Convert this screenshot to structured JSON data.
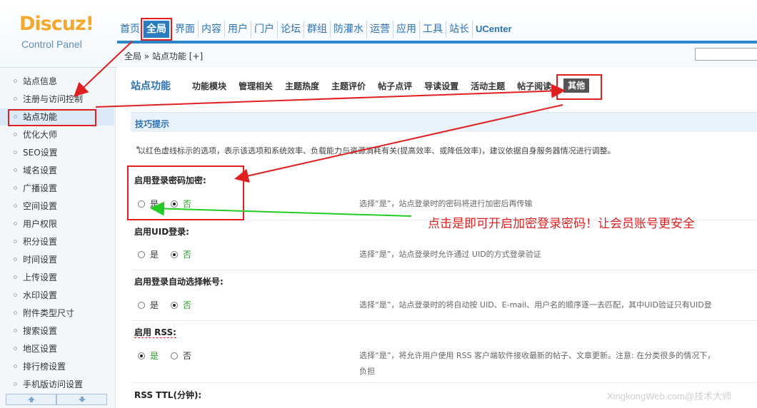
{
  "brand": {
    "logo": "Discuz!",
    "subtitle": "Control Panel"
  },
  "topnav": [
    "首页",
    "全局",
    "界面",
    "内容",
    "用户",
    "门户",
    "论坛",
    "群组",
    "防灌水",
    "运营",
    "应用",
    "工具",
    "站长",
    "UCenter"
  ],
  "topnav_active": "全局",
  "breadcrumb": "全局 » 站点功能  [+]",
  "sidebar": {
    "items": [
      "站点信息",
      "注册与访问控制",
      "站点功能",
      "优化大师",
      "SEO设置",
      "域名设置",
      "广播设置",
      "空间设置",
      "用户权限",
      "积分设置",
      "时间设置",
      "上传设置",
      "水印设置",
      "附件类型尺寸",
      "搜索设置",
      "地区设置",
      "排行榜设置",
      "手机版访问设置"
    ],
    "active": "站点功能"
  },
  "content": {
    "title": "站点功能",
    "subtabs": [
      "功能模块",
      "管理相关",
      "主题热度",
      "主题评价",
      "帖子点评",
      "导读设置",
      "活动主题",
      "帖子阅读",
      "其他"
    ],
    "active_subtab": "其他",
    "tips_title": "技巧提示",
    "tip": "以红色虚线标示的选项，表示该选项和系统效率、负载能力与资源消耗有关(提高效率、或降低效率)，建议依据自身服务器情况进行调整。",
    "settings": [
      {
        "label": "启用登录密码加密:",
        "yes": "是",
        "no": "否",
        "selected": "no",
        "desc": "选择“是”，站点登录时的密码将进行加密后再传输"
      },
      {
        "label": "启用UID登录:",
        "yes": "是",
        "no": "否",
        "selected": "no",
        "desc": "选择“是”，站点登录时允许通过  UID的方式登录验证"
      },
      {
        "label": "启用登录自动选择帐号:",
        "yes": "是",
        "no": "否",
        "selected": "no",
        "desc": "选择“是”，站点登录时的将自动按  UID、E-mail、用户名的顺序逐一去匹配，其中UID验证只有UID登"
      },
      {
        "label": "启用 RSS:",
        "yes": "是",
        "no": "否",
        "selected": "yes",
        "desc": "选择“是”，将允许用户使用  RSS 客户端软件接收最新的帖子、文章更新。注意: 在分类很多的情况下，",
        "desc2": "负担"
      },
      {
        "label": "RSS TTL(分钟):"
      }
    ],
    "annotation": "点击是即可开启加密登录密码！让会员账号更安全",
    "watermark": "XingkongWeb.com@技术大师"
  },
  "colors": {
    "accent": "#2b7bc1",
    "annotation": "#e02020",
    "arrow_green": "#22cc22",
    "logo": "#f4a92c"
  }
}
